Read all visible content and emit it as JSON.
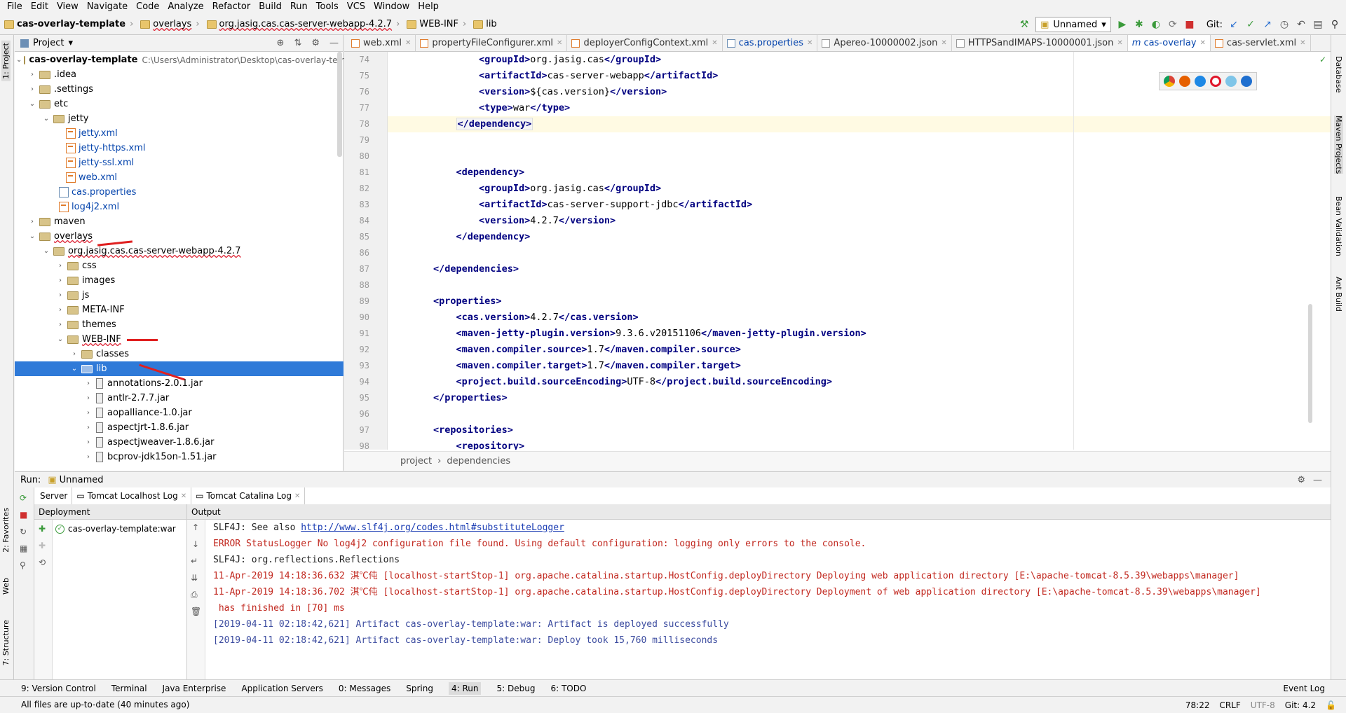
{
  "menu": [
    "File",
    "Edit",
    "View",
    "Navigate",
    "Code",
    "Analyze",
    "Refactor",
    "Build",
    "Run",
    "Tools",
    "VCS",
    "Window",
    "Help"
  ],
  "breadcrumbs": [
    "cas-overlay-template",
    "overlays",
    "org.jasig.cas.cas-server-webapp-4.2.7",
    "WEB-INF",
    "lib"
  ],
  "run_config": "Unnamed",
  "git_label": "Git:",
  "left_tabs": [
    "1: Project",
    "2: Favorites",
    "Web",
    "7: Structure"
  ],
  "right_tabs": [
    "Database",
    "Maven Projects",
    "Bean Validation",
    "Ant Build"
  ],
  "project": {
    "title": "Project",
    "tree": [
      {
        "label": "cas-overlay-template",
        "extra": "C:\\Users\\Administrator\\Desktop\\cas-overlay-temp"
      },
      {
        "label": ".idea"
      },
      {
        "label": ".settings"
      },
      {
        "label": "etc"
      },
      {
        "label": "jetty"
      },
      {
        "label": "jetty.xml"
      },
      {
        "label": "jetty-https.xml"
      },
      {
        "label": "jetty-ssl.xml"
      },
      {
        "label": "web.xml"
      },
      {
        "label": "cas.properties"
      },
      {
        "label": "log4j2.xml"
      },
      {
        "label": "maven"
      },
      {
        "label": "overlays"
      },
      {
        "label": "org.jasig.cas.cas-server-webapp-4.2.7"
      },
      {
        "label": "css"
      },
      {
        "label": "images"
      },
      {
        "label": "js"
      },
      {
        "label": "META-INF"
      },
      {
        "label": "themes"
      },
      {
        "label": "WEB-INF"
      },
      {
        "label": "classes"
      },
      {
        "label": "lib"
      },
      {
        "label": "annotations-2.0.1.jar"
      },
      {
        "label": "antlr-2.7.7.jar"
      },
      {
        "label": "aopalliance-1.0.jar"
      },
      {
        "label": "aspectjrt-1.8.6.jar"
      },
      {
        "label": "aspectjweaver-1.8.6.jar"
      },
      {
        "label": "bcprov-jdk15on-1.51.jar"
      }
    ]
  },
  "editor": {
    "tabs": [
      "web.xml",
      "propertyFileConfigurer.xml",
      "deployerConfigContext.xml",
      "cas.properties",
      "Apereo-10000002.json",
      "HTTPSandIMAPS-10000001.json",
      "cas-overlay",
      "cas-servlet.xml"
    ],
    "active_tab": "cas-overlay",
    "line_numbers": [
      "74",
      "75",
      "76",
      "77",
      "78",
      "79",
      "80",
      "81",
      "82",
      "83",
      "84",
      "85",
      "86",
      "87",
      "88",
      "89",
      "90",
      "91",
      "92",
      "93",
      "94",
      "95",
      "96",
      "97",
      "98"
    ],
    "breadcrumb": [
      "project",
      "dependencies"
    ]
  },
  "run": {
    "title": "Run:",
    "config": "Unnamed",
    "tabs": [
      "Server",
      "Tomcat Localhost Log",
      "Tomcat Catalina Log"
    ],
    "deployment_header": "Deployment",
    "output_header": "Output",
    "artifact": "cas-overlay-template:war",
    "lines": [
      "SLF4J: See also ",
      "http://www.slf4j.org/codes.html#substituteLogger",
      "ERROR StatusLogger No log4j2 configuration file found. Using default configuration: logging only errors to the console.",
      "SLF4J: org.reflections.Reflections",
      "11-Apr-2019 14:18:36.632 淇℃伅 [localhost-startStop-1] org.apache.catalina.startup.HostConfig.deployDirectory Deploying web application directory [E:\\apache-tomcat-8.5.39\\webapps\\manager]",
      "11-Apr-2019 14:18:36.702 淇℃伅 [localhost-startStop-1] org.apache.catalina.startup.HostConfig.deployDirectory Deployment of web application directory [E:\\apache-tomcat-8.5.39\\webapps\\manager]",
      " has finished in [70] ms",
      "[2019-04-11 02:18:42,621] Artifact cas-overlay-template:war: Artifact is deployed successfully",
      "[2019-04-11 02:18:42,621] Artifact cas-overlay-template:war: Deploy took 15,760 milliseconds"
    ]
  },
  "bottom_tools": [
    "9: Version Control",
    "Terminal",
    "Java Enterprise",
    "Application Servers",
    "0: Messages",
    "Spring",
    "4: Run",
    "5: Debug",
    "6: TODO",
    "Event Log"
  ],
  "status": {
    "message": "All files are up-to-date (40 minutes ago)",
    "position": "78:22",
    "line_sep": "CRLF",
    "encoding": "UTF-8",
    "git": "Git: 4.2"
  },
  "colors": {
    "selection": "#2f7ad8",
    "tag": "#000080",
    "error": "#c1271e",
    "info": "#3d4da0"
  }
}
